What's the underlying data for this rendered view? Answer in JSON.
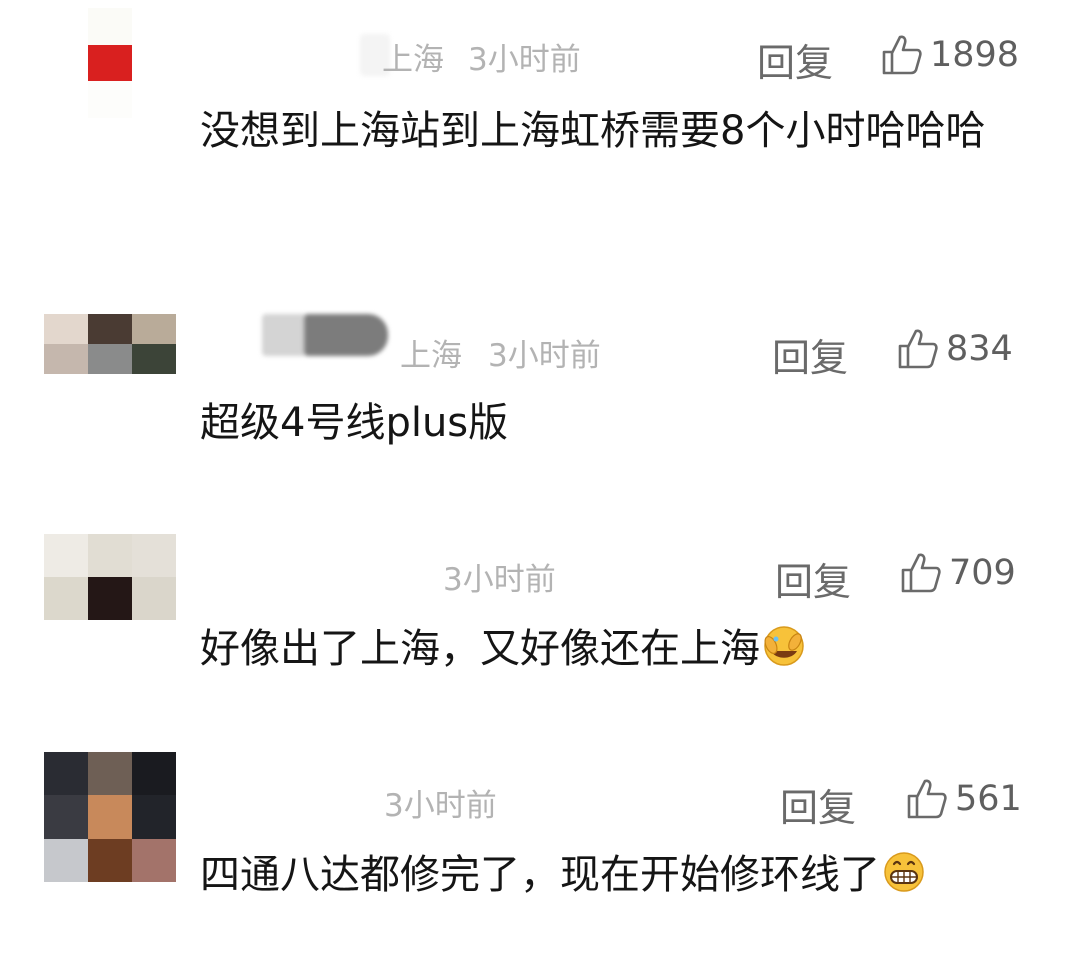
{
  "comments": [
    {
      "location": "上海",
      "time": "3小时前",
      "reply_label": "回复",
      "likes": "1898",
      "text": "没想到上海站到上海虹桥需要8个小时哈哈哈"
    },
    {
      "location": "上海",
      "time": "3小时前",
      "reply_label": "回复",
      "likes": "834",
      "text": "超级4号线plus版"
    },
    {
      "location": "",
      "time": "3小时前",
      "reply_label": "回复",
      "likes": "709",
      "text": "好像出了上海，又好像还在上海",
      "emoji": "facepalm-laugh-emoji"
    },
    {
      "location": "",
      "time": "3小时前",
      "reply_label": "回复",
      "likes": "561",
      "text": "四通八达都修完了，现在开始修环线了",
      "emoji": "grin-emoji"
    }
  ],
  "icons": {
    "like": "thumbs-up-icon"
  },
  "colors": {
    "meta": "#b3b3b3",
    "reply": "#6a6a6a",
    "text": "#151515"
  }
}
